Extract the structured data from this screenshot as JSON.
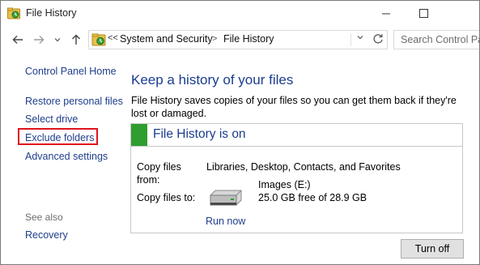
{
  "window": {
    "title": "File History",
    "icon": "file-history-icon"
  },
  "navigation": {
    "back_icon": "arrow-left-icon",
    "forward_icon": "arrow-right-icon",
    "recent_icon": "chevron-down-icon",
    "up_icon": "arrow-up-icon"
  },
  "address": {
    "overflow": "<<",
    "crumbs": [
      "System and Security",
      "File History"
    ],
    "separator": ">",
    "refresh_icon": "refresh-icon"
  },
  "search": {
    "placeholder": "Search Control Panel"
  },
  "sidebar": {
    "home": "Control Panel Home",
    "items": [
      {
        "label": "Restore personal files"
      },
      {
        "label": "Select drive"
      },
      {
        "label": "Exclude folders"
      },
      {
        "label": "Advanced settings"
      }
    ],
    "see_also_heading": "See also",
    "see_also_items": [
      {
        "label": "Recovery"
      }
    ]
  },
  "main": {
    "title": "Keep a history of your files",
    "description": "File History saves copies of your files so you can get them back if they're lost or damaged.",
    "status": {
      "text": "File History is on",
      "color": "#2e9e2e"
    },
    "copy_from_label": "Copy files from:",
    "copy_from_label_line1": "Copy files",
    "copy_from_label_line2": "from:",
    "copy_from_value": "Libraries, Desktop, Contacts, and Favorites",
    "copy_to_label": "Copy files to:",
    "drive_name": "Images (E:)",
    "drive_space": "25.0 GB free of 28.9 GB",
    "run_now": "Run now",
    "turn_off": "Turn off"
  },
  "colors": {
    "link": "#1e3e8c",
    "heading": "#1a3d8f",
    "highlight": "#e0141e"
  }
}
